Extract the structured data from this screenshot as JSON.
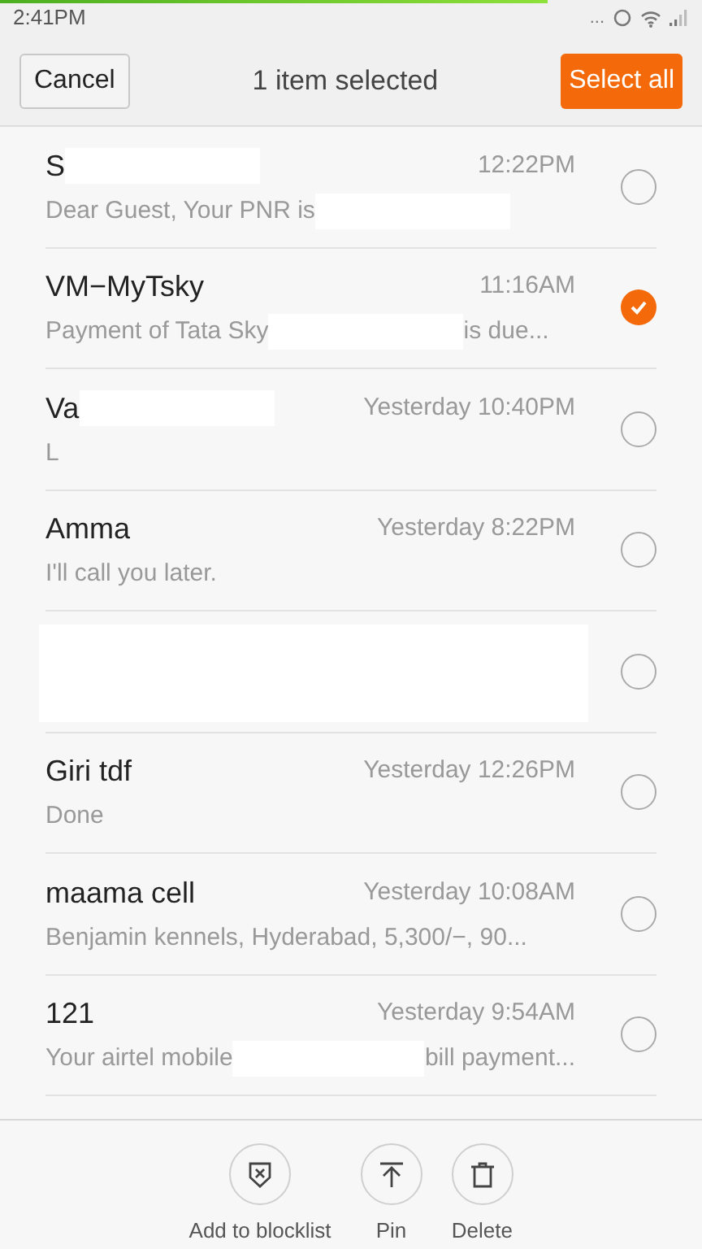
{
  "status_bar": {
    "time": "2:41PM",
    "dots": "...",
    "loading": {
      "level": 0.78
    }
  },
  "header": {
    "cancel": "Cancel",
    "title": "1 item selected",
    "select_all": "Select all"
  },
  "messages": [
    {
      "name": [
        {
          "kind": "text",
          "text": "S"
        },
        {
          "kind": "redaction"
        }
      ],
      "time": "12:22PM",
      "preview": [
        {
          "kind": "text",
          "text": "Dear Guest, Your PNR is"
        },
        {
          "kind": "redaction"
        }
      ],
      "selected": false
    },
    {
      "name": [
        {
          "kind": "text",
          "text": "VM−MyTsky"
        }
      ],
      "time": "11:16AM",
      "preview": [
        {
          "kind": "text",
          "text": "Payment of Tata Sky"
        },
        {
          "kind": "redaction"
        },
        {
          "kind": "text",
          "text": "is due..."
        }
      ],
      "selected": true
    },
    {
      "name": [
        {
          "kind": "text",
          "text": "Va"
        },
        {
          "kind": "redaction"
        }
      ],
      "time": "Yesterday 10:40PM",
      "preview": [
        {
          "kind": "text",
          "text": "L"
        }
      ],
      "selected": false
    },
    {
      "name": [
        {
          "kind": "text",
          "text": "Amma"
        }
      ],
      "time": "Yesterday 8:22PM",
      "preview": [
        {
          "kind": "text",
          "text": "I'll call you later."
        }
      ],
      "selected": false
    },
    {
      "kind": "redacted",
      "selected": false
    },
    {
      "name": [
        {
          "kind": "text",
          "text": "Giri tdf"
        }
      ],
      "time": "Yesterday 12:26PM",
      "preview": [
        {
          "kind": "text",
          "text": "Done"
        }
      ],
      "selected": false
    },
    {
      "name": [
        {
          "kind": "text",
          "text": "maama cell"
        }
      ],
      "time": "Yesterday 10:08AM",
      "preview": [
        {
          "kind": "text",
          "text": "Benjamin kennels, Hyderabad, 5,300/−, 90..."
        }
      ],
      "selected": false
    },
    {
      "name": [
        {
          "kind": "text",
          "text": "121"
        }
      ],
      "time": "Yesterday 9:54AM",
      "preview": [
        {
          "kind": "text",
          "text": "Your airtel mobile"
        },
        {
          "kind": "redaction"
        },
        {
          "kind": "text",
          "text": "bill payment..."
        }
      ],
      "selected": false
    }
  ],
  "actions": [
    {
      "kind": "block",
      "label": "Add to blocklist"
    },
    {
      "kind": "pin",
      "label": "Pin"
    },
    {
      "kind": "delete",
      "label": "Delete"
    }
  ]
}
